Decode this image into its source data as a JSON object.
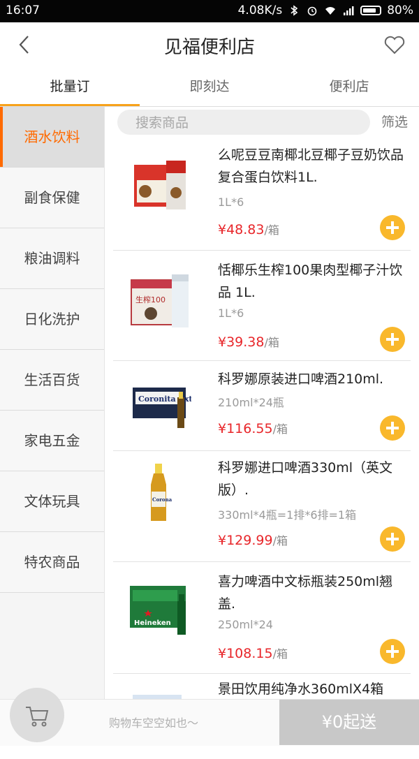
{
  "status_bar": {
    "time": "16:07",
    "network_speed": "4.08K/s",
    "battery": "80%"
  },
  "header": {
    "title": "见福便利店",
    "icons": [
      "back-arrow-icon",
      "heart-icon"
    ]
  },
  "tabs": [
    {
      "label": "批量订",
      "active": true
    },
    {
      "label": "即刻达",
      "active": false
    },
    {
      "label": "便利店",
      "active": false
    }
  ],
  "sidebar": {
    "categories": [
      {
        "label": "酒水饮料",
        "active": true
      },
      {
        "label": "副食保健"
      },
      {
        "label": "粮油调料"
      },
      {
        "label": "日化洗护"
      },
      {
        "label": "生活百货"
      },
      {
        "label": "家电五金"
      },
      {
        "label": "文体玩具"
      },
      {
        "label": "特农商品"
      }
    ]
  },
  "search": {
    "placeholder": "搜索商品",
    "filter_label": "筛选"
  },
  "products": [
    {
      "name": "么呢豆豆南椰北豆椰子豆奶饮品复合蛋白饮料1L.",
      "spec": "1L*6",
      "price": "¥48.83",
      "unit": "/箱"
    },
    {
      "name": "恬椰乐生榨100果肉型椰子汁饮品 1L.",
      "spec": "1L*6",
      "price": "¥39.38",
      "unit": "/箱"
    },
    {
      "name": "科罗娜原装进口啤酒210ml.",
      "spec": "210ml*24瓶",
      "price": "¥116.55",
      "unit": "/箱"
    },
    {
      "name": "科罗娜进口啤酒330ml（英文版）.",
      "spec": "330ml*4瓶=1排*6排=1箱",
      "price": "¥129.99",
      "unit": "/箱"
    },
    {
      "name": "喜力啤酒中文标瓶装250ml翘盖.",
      "spec": "250ml*24",
      "price": "¥108.15",
      "unit": "/箱"
    },
    {
      "name": "景田饮用纯净水360mlX4箱"
    }
  ],
  "image_text": {
    "coronita": "Coronita Extra",
    "heineken": "Heineken",
    "corona": "Corona",
    "coconut_box": "生榨100"
  },
  "cart": {
    "empty_text": "购物车空空如也～",
    "checkout_label": "¥0起送"
  },
  "colors": {
    "accent": "#ff6a00",
    "price": "#e8262a",
    "add_button": "#f9b82c",
    "tab_underline": "#f7a21b"
  }
}
